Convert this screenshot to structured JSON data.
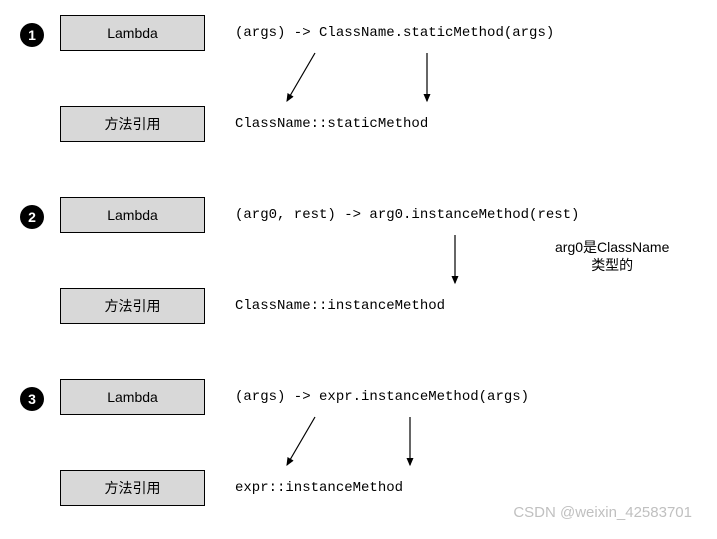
{
  "sections": [
    {
      "marker": "1",
      "lambda_label": "Lambda",
      "lambda_code": "(args) -> ClassName.staticMethod(args)",
      "ref_label": "方法引用",
      "ref_code": "ClassName::staticMethod",
      "note": ""
    },
    {
      "marker": "2",
      "lambda_label": "Lambda",
      "lambda_code": "(arg0, rest) -> arg0.instanceMethod(rest)",
      "ref_label": "方法引用",
      "ref_code": "ClassName::instanceMethod",
      "note": "arg0是ClassName\n类型的"
    },
    {
      "marker": "3",
      "lambda_label": "Lambda",
      "lambda_code": "(args) -> expr.instanceMethod(args)",
      "ref_label": "方法引用",
      "ref_code": "expr::instanceMethod",
      "note": ""
    }
  ],
  "watermark": "CSDN @weixin_42583701"
}
